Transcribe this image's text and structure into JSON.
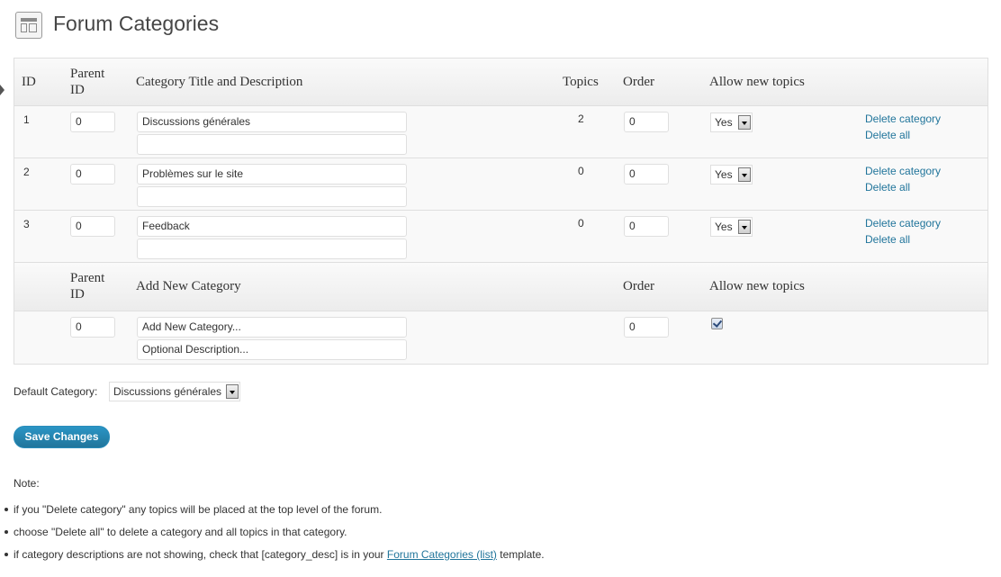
{
  "header": {
    "icon": "forum-categories-icon",
    "title": "Forum Categories"
  },
  "table": {
    "columns": {
      "id": "ID",
      "parent_line1": "Parent",
      "parent_line2": "ID",
      "title": "Category Title and Description",
      "topics": "Topics",
      "order": "Order",
      "allow": "Allow new topics"
    },
    "rows": [
      {
        "id": "1",
        "parent": "0",
        "title": "Discussions générales",
        "description": "",
        "topics": "2",
        "order": "0",
        "allow": "Yes",
        "delete_category": "Delete category",
        "delete_all": "Delete all"
      },
      {
        "id": "2",
        "parent": "0",
        "title": "Problèmes sur le site",
        "description": "",
        "topics": "0",
        "order": "0",
        "allow": "Yes",
        "delete_category": "Delete category",
        "delete_all": "Delete all"
      },
      {
        "id": "3",
        "parent": "0",
        "title": "Feedback",
        "description": "",
        "topics": "0",
        "order": "0",
        "allow": "Yes",
        "delete_category": "Delete category",
        "delete_all": "Delete all"
      }
    ],
    "add_new": {
      "header_parent_line1": "Parent",
      "header_parent_line2": "ID",
      "header_title": "Add New Category",
      "header_order": "Order",
      "header_allow": "Allow new topics",
      "parent": "0",
      "title": "Add New Category...",
      "description": "Optional Description...",
      "order": "0",
      "allow_checked": true
    }
  },
  "default_category": {
    "label": "Default Category:",
    "value": "Discussions générales"
  },
  "save_button": "Save Changes",
  "notes": {
    "title": "Note:",
    "item1": "if you \"Delete category\" any topics will be placed at the top level of the forum.",
    "item2": "choose \"Delete all\" to delete a category and all topics in that category.",
    "item3_before": "if category descriptions are not showing, check that [category_desc] is in your ",
    "item3_link": "Forum Categories (list)",
    "item3_after": " template."
  },
  "colors": {
    "link": "#21759b",
    "button": "#21759b",
    "header_bg": "#ececec"
  }
}
